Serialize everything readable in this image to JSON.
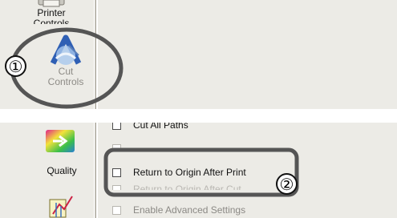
{
  "top_panel": {
    "sidebar": {
      "printer_controls": {
        "label_line1": "Printer",
        "label_line2": "Controls",
        "icon": "printer-controls-icon"
      },
      "cut_controls": {
        "label_line1": "Cut",
        "label_line2": "Controls",
        "icon": "cut-controls-icon"
      }
    },
    "callout": {
      "label": "①"
    }
  },
  "bottom_panel": {
    "sidebar": {
      "quality": {
        "label": "Quality",
        "icon": "quality-icon"
      },
      "color_icon": "color-management-icon"
    },
    "options": [
      {
        "label": "Cut All Paths",
        "checked": false,
        "enabled": true
      },
      {
        "label": "",
        "checked": false,
        "enabled": false
      },
      {
        "label": "Return to Origin After Print",
        "checked": false,
        "enabled": true
      },
      {
        "label": "Return to Origin After Cut",
        "checked": false,
        "enabled": false
      },
      {
        "label": "Enable Advanced Settings",
        "checked": false,
        "enabled": false
      }
    ],
    "callout": {
      "label": "②"
    }
  },
  "colors": {
    "panel": "#ecebe6",
    "highlight": "#555555"
  }
}
